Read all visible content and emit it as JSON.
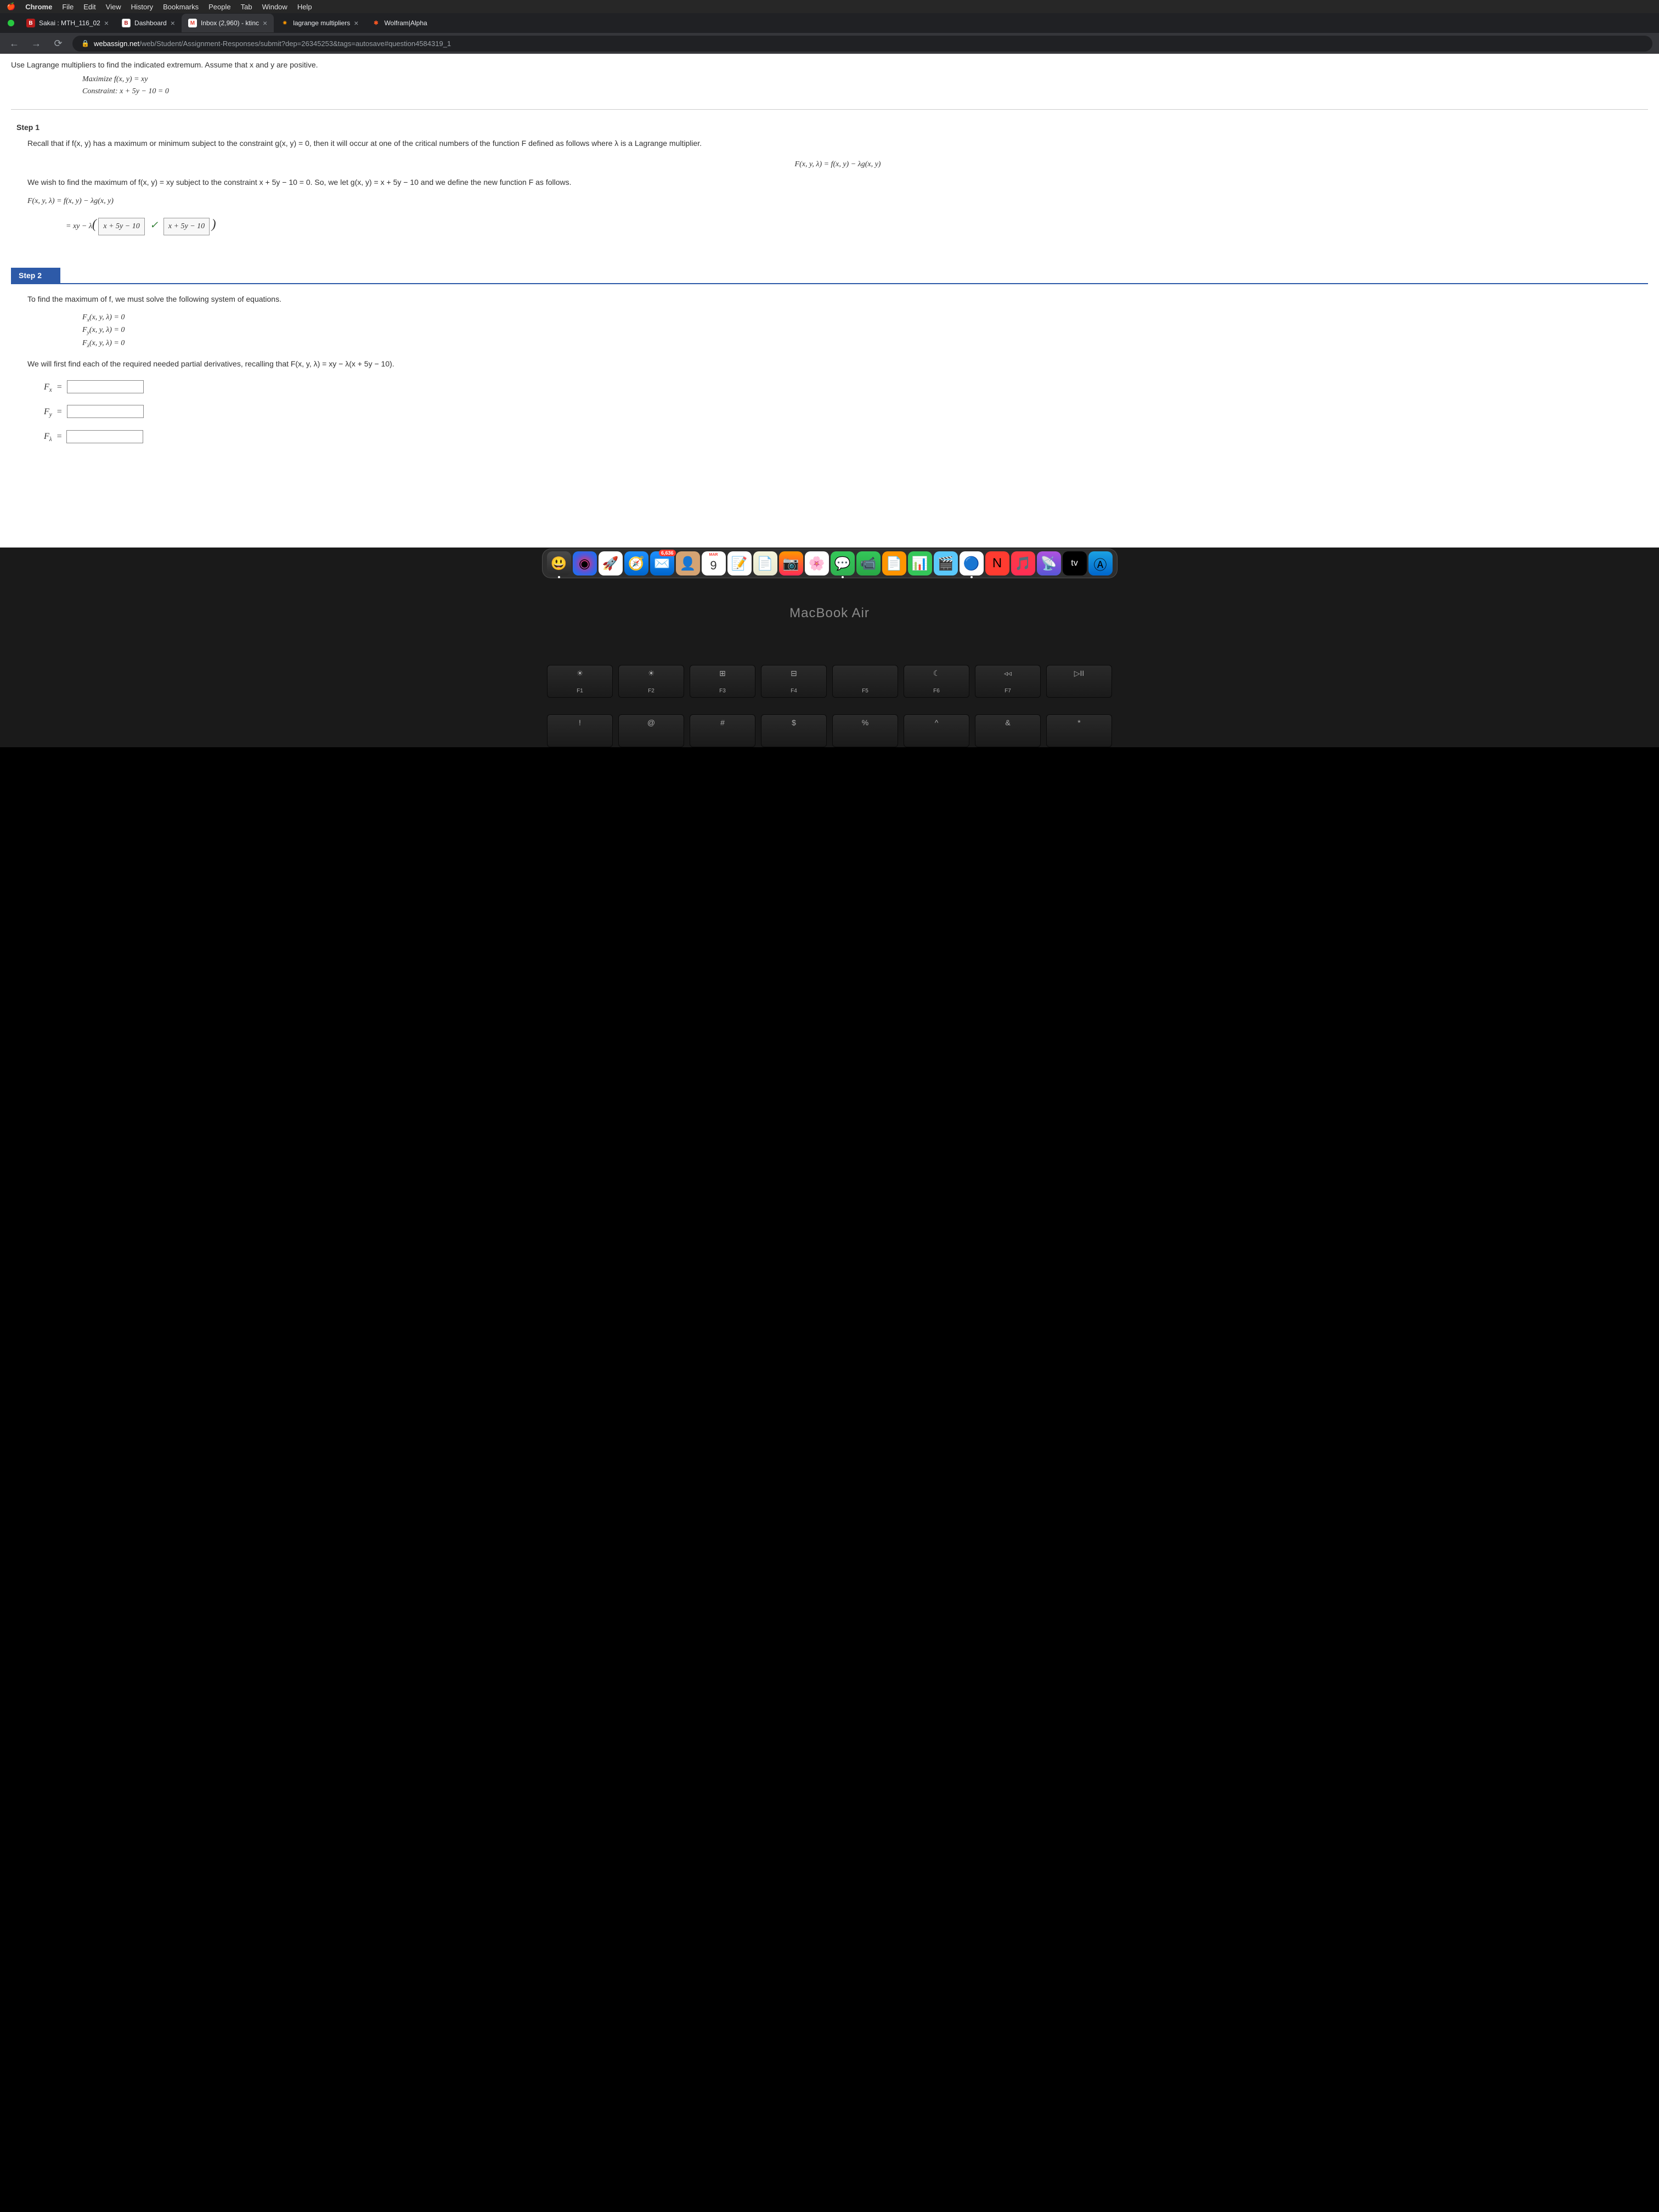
{
  "menubar": [
    "Chrome",
    "File",
    "Edit",
    "View",
    "History",
    "Bookmarks",
    "People",
    "Tab",
    "Window",
    "Help"
  ],
  "tabs": [
    {
      "fav": "B",
      "favBg": "#b71c1c",
      "favColor": "#fff",
      "title": "Sakai : MTH_116_02",
      "active": false
    },
    {
      "fav": "B",
      "favBg": "#fff",
      "favColor": "#b71c1c",
      "title": "Dashboard",
      "active": false
    },
    {
      "fav": "M",
      "favBg": "#fff",
      "favColor": "#ea4335",
      "title": "Inbox (2,960) - ktinc",
      "active": true
    },
    {
      "fav": "✷",
      "favBg": "#333",
      "favColor": "#ff9800",
      "title": "lagrange multipliers",
      "active": false
    },
    {
      "fav": "✱",
      "favBg": "#333",
      "favColor": "#ff5722",
      "title": "Wolfram|Alpha",
      "active": false
    }
  ],
  "url": {
    "domain": "webassign.net",
    "path": "/web/Student/Assignment-Responses/submit?dep=26345253&tags=autosave#question4584319_1"
  },
  "content": {
    "intro": "Use Lagrange multipliers to find the indicated extremum. Assume that x and y are positive.",
    "maximize": "Maximize f(x, y) = xy",
    "constraint": "Constraint: x + 5y − 10 = 0",
    "step1": "Step 1",
    "s1p1": "Recall that if f(x, y) has a maximum or minimum subject to the constraint g(x, y) = 0, then it will occur at one of the critical numbers of the function F defined as follows where λ is a Lagrange multiplier.",
    "s1f1": "F(x, y, λ) = f(x, y) − λg(x, y)",
    "s1p2": "We wish to find the maximum of f(x, y) = xy subject to the constraint x + 5y − 10 = 0. So, we let g(x, y) = x + 5y − 10 and we define the new function F as follows.",
    "s1e1": "F(x, y, λ)  =  f(x, y) − λg(x, y)",
    "s1e2pre": "=  xy − λ",
    "ans1": "x + 5y − 10",
    "ans2": "x + 5y − 10",
    "step2": "Step 2",
    "s2p1": "To find the maximum of f, we must solve the following system of equations.",
    "sys1": "Fx(x, y, λ)  =  0",
    "sys2": "Fy(x, y, λ)  =  0",
    "sys3": "Fλ(x, y, λ)  =  0",
    "s2p2": "We will first find each of the required needed partial derivatives, recalling that F(x, y, λ) = xy − λ(x + 5y − 10).",
    "fx": "Fx  =",
    "fy": "Fy  =",
    "fl": "Fλ  ="
  },
  "dock": {
    "mailBadge": "6,636",
    "calMonth": "MAR",
    "calDay": "9",
    "tv": "tv"
  },
  "laptop": "MacBook Air",
  "fkeys": [
    {
      "icon": "☀",
      "label": "F1",
      "dim": true
    },
    {
      "icon": "☀",
      "label": "F2"
    },
    {
      "icon": "⊞",
      "label": "F3"
    },
    {
      "icon": "⊟",
      "label": "F4"
    },
    {
      "icon": "",
      "label": "F5"
    },
    {
      "icon": "☾",
      "label": "F6"
    },
    {
      "icon": "◃◃",
      "label": "F7"
    },
    {
      "icon": "▷II",
      "label": ""
    }
  ],
  "numkeys": [
    "!",
    "@",
    "#",
    "$",
    "%",
    "^",
    "&",
    "*"
  ]
}
